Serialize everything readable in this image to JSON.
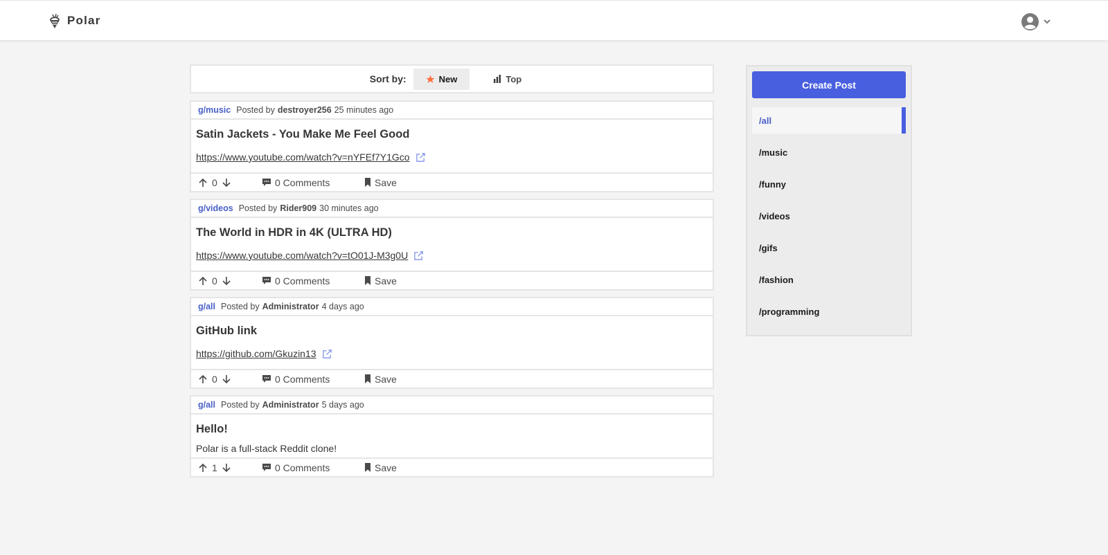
{
  "app": {
    "brand_name": "Polar",
    "logo_icon": "ice-cream-icon",
    "accent_color": "#485fe0",
    "star_color": "#ff6f3c"
  },
  "sort": {
    "label": "Sort by:",
    "options": [
      {
        "label": "New",
        "icon": "star-icon",
        "active": true
      },
      {
        "label": "Top",
        "icon": "bar-chart-icon",
        "active": false
      }
    ]
  },
  "posts": [
    {
      "group": "g/music",
      "posted_by_label": "Posted by",
      "author": "destroyer256",
      "time": "25 minutes ago",
      "title": "Satin Jackets - You Make Me Feel Good",
      "link": "https://www.youtube.com/watch?v=nYFEf7Y1Gco",
      "votes": "0",
      "comments": "0 Comments",
      "save": "Save"
    },
    {
      "group": "g/videos",
      "posted_by_label": "Posted by",
      "author": "Rider909",
      "time": "30 minutes ago",
      "title": "The World in HDR in 4K (ULTRA HD)",
      "link": "https://www.youtube.com/watch?v=tO01J-M3g0U",
      "votes": "0",
      "comments": "0 Comments",
      "save": "Save"
    },
    {
      "group": "g/all",
      "posted_by_label": "Posted by",
      "author": "Administrator",
      "time": "4 days ago",
      "title": "GitHub link",
      "link": "https://github.com/Gkuzin13",
      "votes": "0",
      "comments": "0 Comments",
      "save": "Save"
    },
    {
      "group": "g/all",
      "posted_by_label": "Posted by",
      "author": "Administrator",
      "time": "5 days ago",
      "title": "Hello!",
      "text": "Polar is a full-stack Reddit clone!",
      "votes": "1",
      "comments": "0 Comments",
      "save": "Save"
    }
  ],
  "sidebar": {
    "create_label": "Create Post",
    "groups": [
      {
        "label": "/all",
        "active": true
      },
      {
        "label": "/music",
        "active": false
      },
      {
        "label": "/funny",
        "active": false
      },
      {
        "label": "/videos",
        "active": false
      },
      {
        "label": "/gifs",
        "active": false
      },
      {
        "label": "/fashion",
        "active": false
      },
      {
        "label": "/programming",
        "active": false
      }
    ]
  }
}
